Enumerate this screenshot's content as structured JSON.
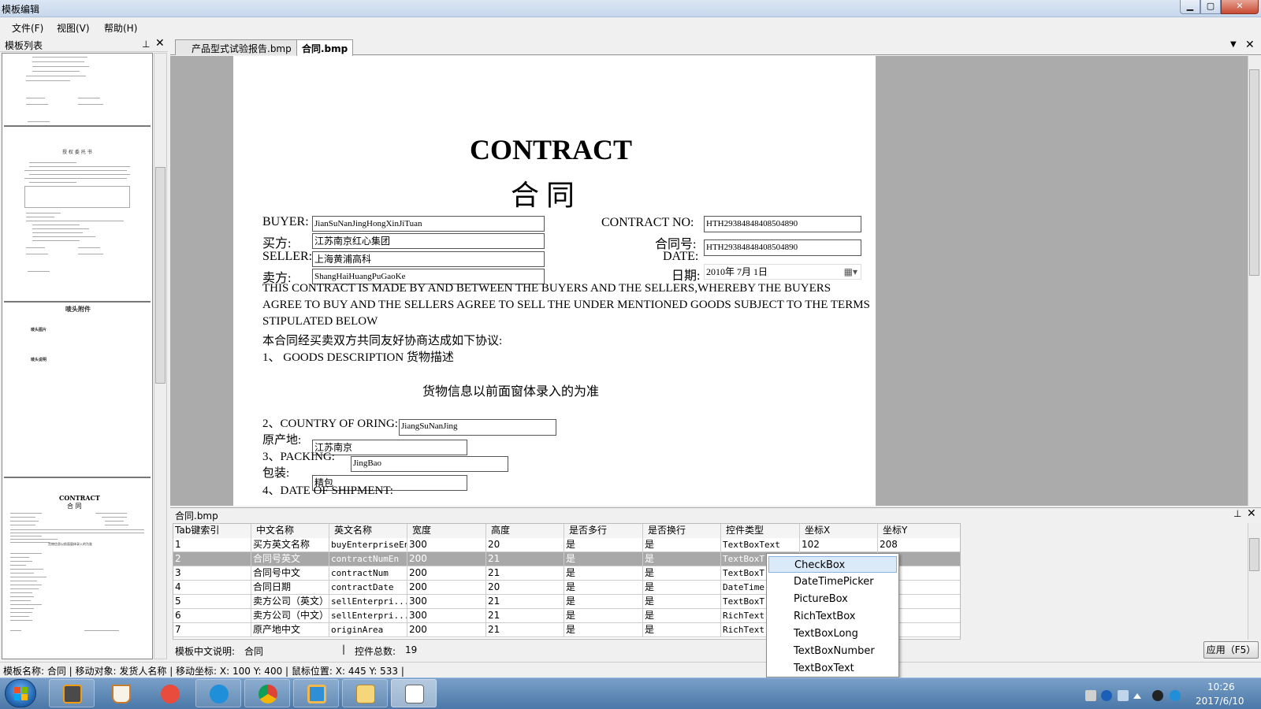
{
  "window": {
    "title": "模板编辑",
    "min_glyph": "▁",
    "max_glyph": "▢",
    "close_glyph": "✕"
  },
  "menu": {
    "file": "文件(F)",
    "view": "视图(V)",
    "help": "帮助(H)"
  },
  "left_panel": {
    "title": "模板列表",
    "pin": "⊥",
    "close": "✕",
    "thumb2_title": "授 权 委 托 书",
    "thumb3_title": "唛头附件",
    "thumb3_line1": "唛头图片",
    "thumb3_line2": "唛头说明",
    "thumb4_title": "CONTRACT",
    "thumb4_subtitle": "合   同",
    "thumb4_goods": "货物信息以前面窗体录入的为准"
  },
  "tabs": [
    {
      "label": "产品型式试验报告.bmp"
    },
    {
      "label": "合同.bmp"
    }
  ],
  "tab_controls": {
    "menu": "▼",
    "close": "✕"
  },
  "document": {
    "title_en": "CONTRACT",
    "title_cn": "合    同",
    "buyer_label": "BUYER:",
    "buyer_value": "JianSuNanJingHongXinJiTuan",
    "buyer_cn_label": "买方:",
    "buyer_cn_value": "江苏南京红心集团",
    "seller_label": "SELLER:",
    "seller_value": "上海黄浦高科",
    "seller_cn_label": "卖方:",
    "seller_cn_value": "ShangHaiHuangPuGaoKe",
    "contract_no_label": "CONTRACT NO:",
    "contract_no_value": "HTH29384848408504890",
    "contract_no_cn_label": "合同号:",
    "contract_no_cn_value": "HTH29384848408504890",
    "date_label": "DATE:",
    "date_cn_label": "日期:",
    "date_value": "2010年  7月  1日",
    "date_dropdown": "▦▾",
    "para1": "THIS CONTRACT IS MADE BY AND BETWEEN THE BUYERS AND THE SELLERS,WHEREBY THE BUYERS",
    "para2": "AGREE TO BUY AND THE SELLERS AGREE TO SELL THE UNDER MENTIONED GOODS SUBJECT TO THE TERMS",
    "para3": "STIPULATED BELOW",
    "para_cn": "本合同经买卖双方共同友好协商达成如下协议:",
    "item1": "1、 GOODS DESCRIPTION  货物描述",
    "goods_note": "货物信息以前面窗体录入的为准",
    "item2": "2、COUNTRY OF ORING:",
    "country_value": "JiangSuNanJing",
    "origin_label": "原产地:",
    "origin_value": "江苏南京",
    "item3": "3、PACKING:",
    "packing_value": "JingBao",
    "packing_cn_label": "包装:",
    "packing_cn_value": "精包",
    "item4": "4、DATE OF SHIPMENT:"
  },
  "bottom_panel": {
    "title": "合同.bmp",
    "pin": "⊥",
    "close": "✕",
    "columns": [
      "Tab键索引",
      "中文名称",
      "英文名称",
      "宽度",
      "高度",
      "是否多行",
      "是否换行",
      "控件类型",
      "坐标X",
      "坐标Y"
    ],
    "rows": [
      [
        "1",
        "买方英文名称",
        "buyEnterpriseEn",
        "300",
        "20",
        "是",
        "是",
        "TextBoxText",
        "102",
        "208"
      ],
      [
        "2",
        "合同号英文",
        "contractNumEn",
        "200",
        "21",
        "是",
        "是",
        "TextBoxT",
        "",
        ""
      ],
      [
        "3",
        "合同号中文",
        "contractNum",
        "200",
        "21",
        "是",
        "是",
        "TextBoxT",
        "",
        ""
      ],
      [
        "4",
        "合同日期",
        "contractDate",
        "200",
        "20",
        "是",
        "是",
        "DateTime",
        "",
        ""
      ],
      [
        "5",
        "卖方公司（英文）",
        "sellEnterpri...",
        "300",
        "21",
        "是",
        "是",
        "TextBoxT",
        "",
        ""
      ],
      [
        "6",
        "卖方公司（中文）",
        "sellEnterpri...",
        "300",
        "21",
        "是",
        "是",
        "RichText",
        "",
        ""
      ],
      [
        "7",
        "原产地中文",
        "originArea",
        "200",
        "21",
        "是",
        "是",
        "RichText",
        "",
        ""
      ]
    ],
    "selected_row": 2,
    "desc_label": "模板中文说明:",
    "desc_value": "合同",
    "separator": "|",
    "count_label": "控件总数:",
    "count_value": "19",
    "apply_button": "应用（F5）"
  },
  "popup_options": [
    "CheckBox",
    "DateTimePicker",
    "PictureBox",
    "RichTextBox",
    "TextBoxLong",
    "TextBoxNumber",
    "TextBoxText"
  ],
  "status_bar": "模板名称:  合同  |  移动对象:  发货人名称  |  移动坐标:  X:  100  Y:  400  |  鼠标位置:  X:  445  Y:  533  |",
  "taskbar": {
    "time": "10:26",
    "date": "2017/6/10"
  }
}
